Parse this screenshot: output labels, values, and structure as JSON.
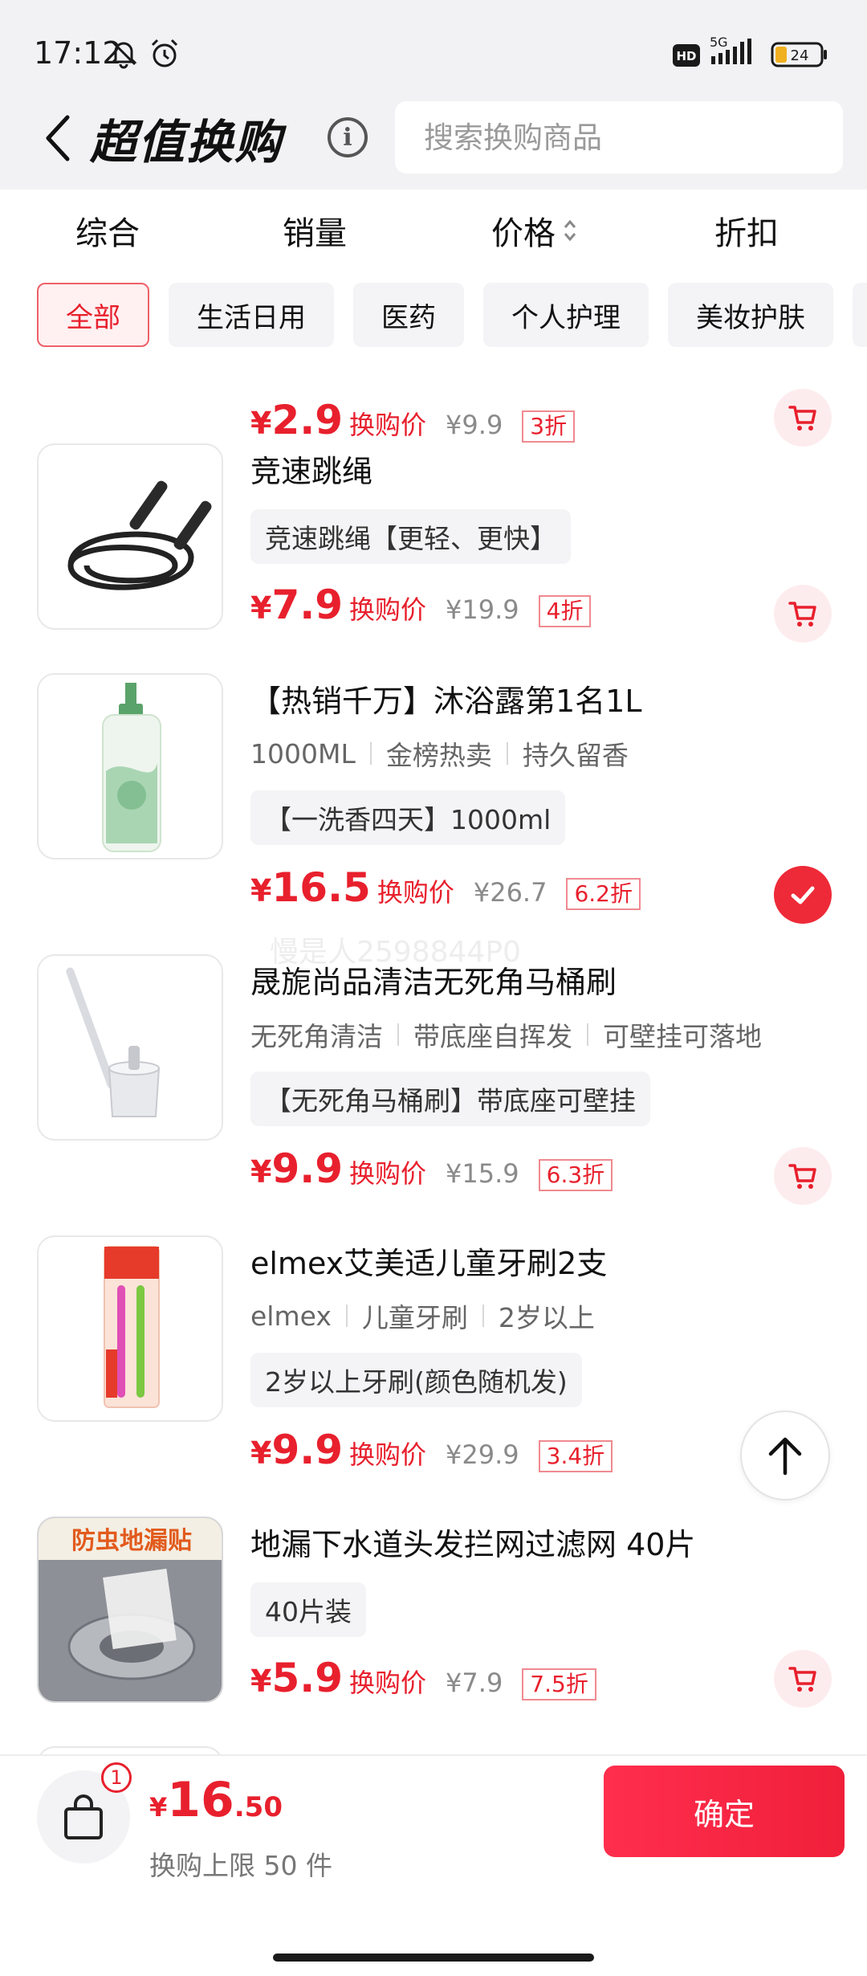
{
  "status_bar": {
    "time": "17:12",
    "network": "5G",
    "battery": "24",
    "hd_label": "HD",
    "icons": [
      "bell-muted-icon",
      "alarm-icon",
      "hd-icon",
      "signal-icon",
      "battery-icon"
    ]
  },
  "header": {
    "title": "超值换购",
    "search_placeholder": "搜索换购商品",
    "info_label": "i"
  },
  "sort_tabs": [
    {
      "label": "综合"
    },
    {
      "label": "销量"
    },
    {
      "label": "价格"
    },
    {
      "label": "折扣"
    }
  ],
  "categories": [
    {
      "label": "全部",
      "active": true
    },
    {
      "label": "生活日用"
    },
    {
      "label": "医药"
    },
    {
      "label": "个人护理"
    },
    {
      "label": "美妆护肤"
    }
  ],
  "products": [
    {
      "title": "",
      "price_symbol": "¥",
      "price": "2.9",
      "price_label": "换购价",
      "original_price": "¥9.9",
      "discount": "3折",
      "selected": false
    },
    {
      "title": "竞速跳绳",
      "tags": [],
      "spec": "竞速跳绳【更轻、更快】",
      "price_symbol": "¥",
      "price": "7.9",
      "price_label": "换购价",
      "original_price": "¥19.9",
      "discount": "4折",
      "selected": false
    },
    {
      "title": "【热销千万】沐浴露第1名1L",
      "tags": [
        "1000ML",
        "金榜热卖",
        "持久留香"
      ],
      "spec": "【一洗香四天】1000ml",
      "price_symbol": "¥",
      "price": "16.5",
      "price_label": "换购价",
      "original_price": "¥26.7",
      "discount": "6.2折",
      "selected": true
    },
    {
      "title": "晟旎尚品清洁无死角马桶刷",
      "tags": [
        "无死角清洁",
        "带底座自挥发",
        "可壁挂可落地"
      ],
      "spec": "【无死角马桶刷】带底座可壁挂",
      "price_symbol": "¥",
      "price": "9.9",
      "price_label": "换购价",
      "original_price": "¥15.9",
      "discount": "6.3折",
      "selected": false
    },
    {
      "title": "elmex艾美适儿童牙刷2支",
      "tags": [
        "elmex",
        "儿童牙刷",
        "2岁以上"
      ],
      "spec": "2岁以上牙刷(颜色随机发)",
      "price_symbol": "¥",
      "price": "9.9",
      "price_label": "换购价",
      "original_price": "¥29.9",
      "discount": "3.4折",
      "selected": false
    },
    {
      "title": "地漏下水道头发拦网过滤网 40片",
      "tags": [],
      "spec": "40片装",
      "thumb_text": "防虫地漏贴",
      "price_symbol": "¥",
      "price": "5.9",
      "price_label": "换购价",
      "original_price": "¥7.9",
      "discount": "7.5折",
      "selected": false
    }
  ],
  "watermark": "慢是人2598844P0",
  "bottom_bar": {
    "cart_count": "1",
    "total_symbol": "¥",
    "total_int": "16",
    "total_dec": ".50",
    "limit_text": "换购上限 50 件",
    "confirm_label": "确定"
  },
  "colors": {
    "accent": "#e8202d",
    "confirm_gradient_start": "#ff2e4d",
    "confirm_gradient_end": "#f01f3a",
    "header_bg": "#f2f2f4"
  }
}
